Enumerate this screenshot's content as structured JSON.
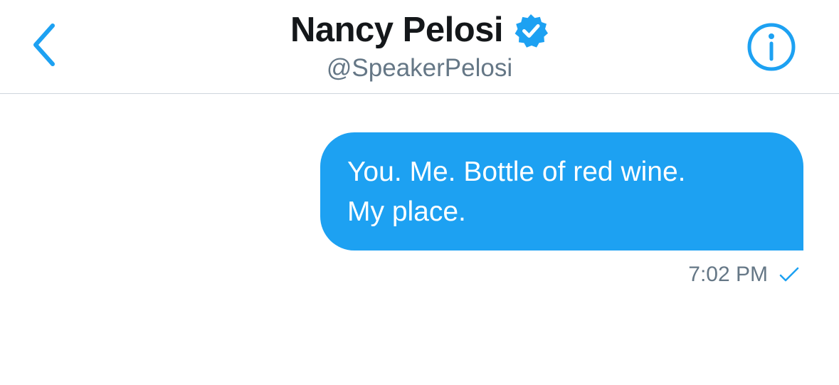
{
  "header": {
    "name": "Nancy Pelosi",
    "handle": "@SpeakerPelosi",
    "icons": {
      "back": "chevron-left-icon",
      "verified": "verified-badge-icon",
      "info": "info-icon"
    }
  },
  "conversation": {
    "messages": [
      {
        "text": "You. Me. Bottle of red wine.\nMy place.",
        "time": "7:02 PM",
        "status_icon": "check-icon"
      }
    ]
  },
  "colors": {
    "accent": "#1DA1F2",
    "name_text": "#14171A",
    "secondary_text": "#657786",
    "divider": "#CFD6DC"
  }
}
